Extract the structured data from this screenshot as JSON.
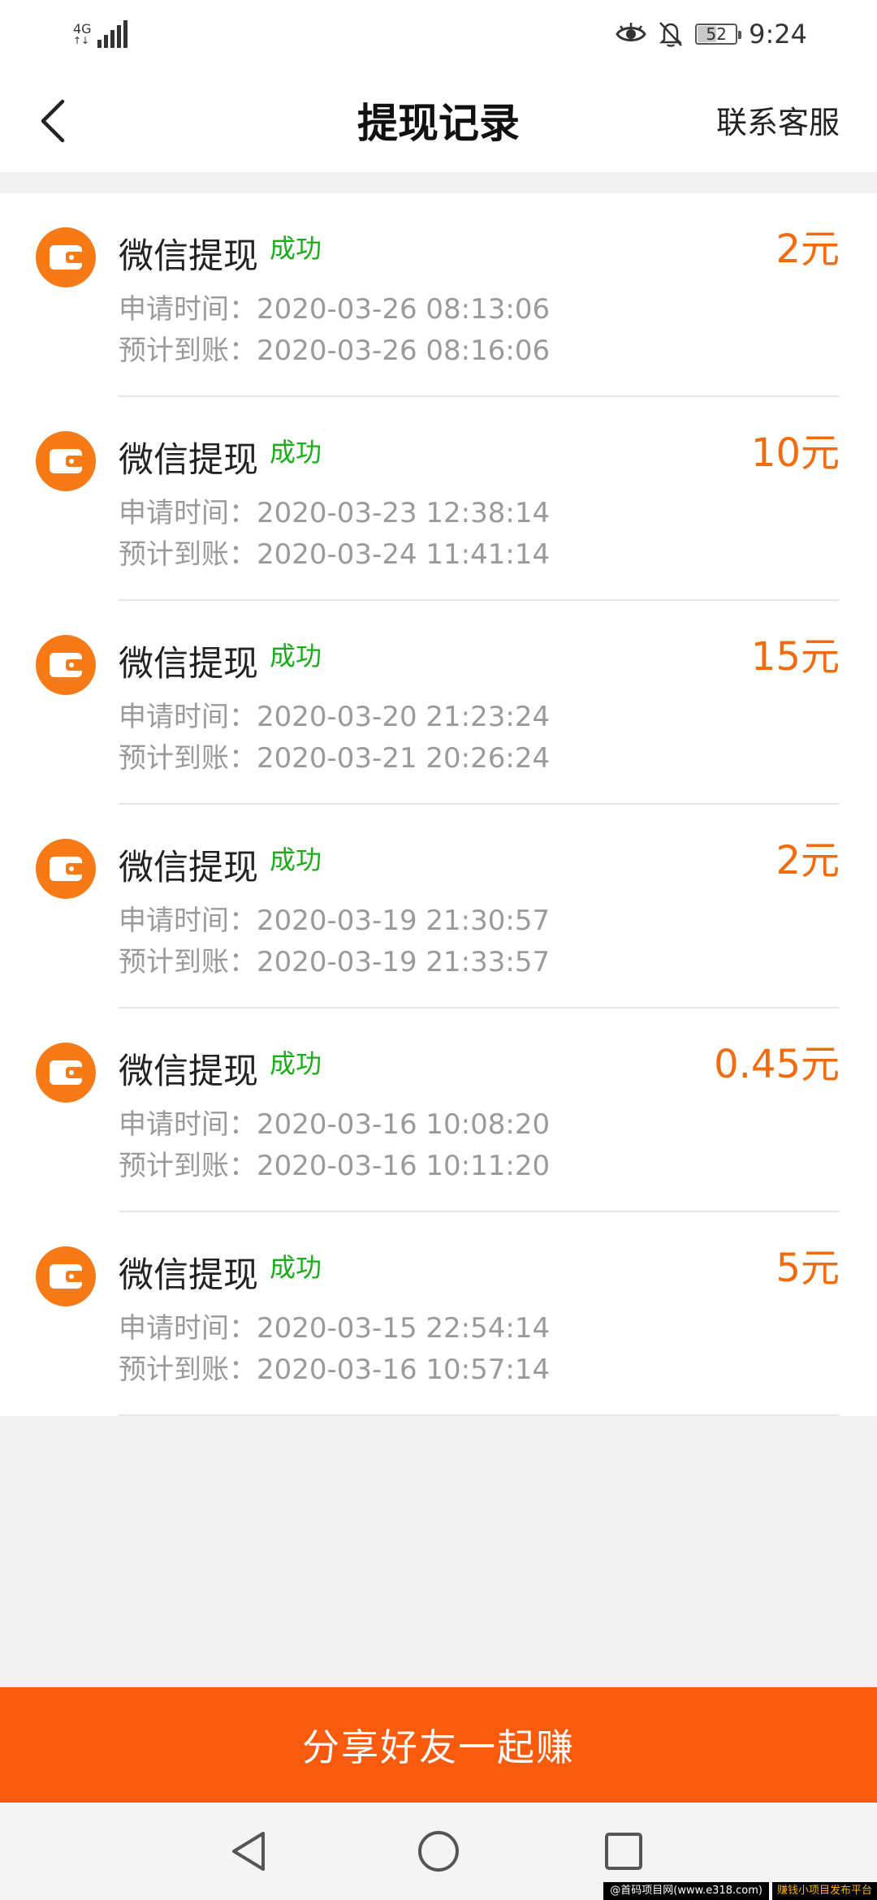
{
  "status_bar": {
    "network_top": "4G",
    "network_bottom": "↑↓",
    "battery_level": 52,
    "battery_text": "52",
    "time": "9:24",
    "icons": [
      "eye-icon",
      "bell-off-icon",
      "battery-icon",
      "signal-icon"
    ]
  },
  "header": {
    "back_icon": "chevron-left-icon",
    "title": "提现记录",
    "action_label": "联系客服"
  },
  "records": [
    {
      "title": "微信提现",
      "status": "成功",
      "amount": "2元",
      "apply_time": "申请时间：2020-03-26 08:13:06",
      "arrival_time": "预计到账：2020-03-26 08:16:06"
    },
    {
      "title": "微信提现",
      "status": "成功",
      "amount": "10元",
      "apply_time": "申请时间：2020-03-23 12:38:14",
      "arrival_time": "预计到账：2020-03-24 11:41:14"
    },
    {
      "title": "微信提现",
      "status": "成功",
      "amount": "15元",
      "apply_time": "申请时间：2020-03-20 21:23:24",
      "arrival_time": "预计到账：2020-03-21 20:26:24"
    },
    {
      "title": "微信提现",
      "status": "成功",
      "amount": "2元",
      "apply_time": "申请时间：2020-03-19 21:30:57",
      "arrival_time": "预计到账：2020-03-19 21:33:57"
    },
    {
      "title": "微信提现",
      "status": "成功",
      "amount": "0.45元",
      "apply_time": "申请时间：2020-03-16 10:08:20",
      "arrival_time": "预计到账：2020-03-16 10:11:20"
    },
    {
      "title": "微信提现",
      "status": "成功",
      "amount": "5元",
      "apply_time": "申请时间：2020-03-15 22:54:14",
      "arrival_time": "预计到账：2020-03-16 10:57:14"
    }
  ],
  "share_button_label": "分享好友一起赚",
  "nav": {
    "icons": [
      "nav-back-icon",
      "nav-home-icon",
      "nav-recent-icon"
    ]
  },
  "watermark": {
    "left": "@首码项目网(www.e318.com)",
    "right": "赚钱小项目发布平台"
  },
  "colors": {
    "accent": "#fa5a0c",
    "amount": "#f26c0d",
    "success": "#1aad19",
    "icon_bg": "#f77a17"
  }
}
